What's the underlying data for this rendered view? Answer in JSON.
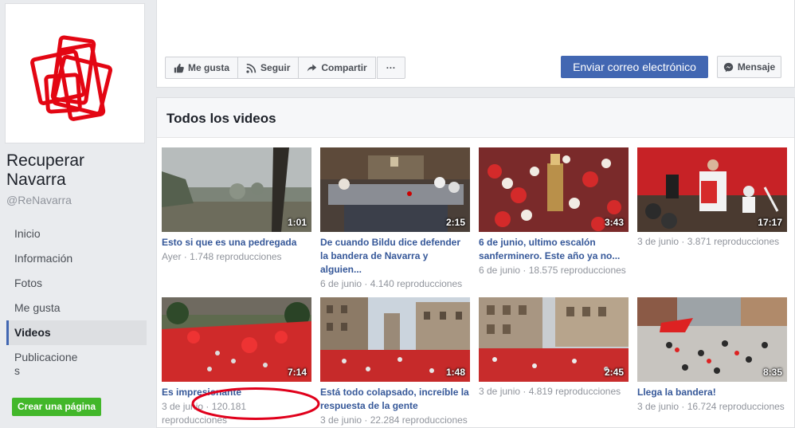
{
  "page": {
    "name": "Recuperar Navarra",
    "handle": "@ReNavarra"
  },
  "nav": {
    "items": [
      {
        "label": "Inicio"
      },
      {
        "label": "Información"
      },
      {
        "label": "Fotos"
      },
      {
        "label": "Me gusta"
      },
      {
        "label": "Videos",
        "active": true
      },
      {
        "label": "Publicaciones"
      }
    ],
    "create_page": "Crear una página"
  },
  "actions": {
    "like": "Me gusta",
    "follow": "Seguir",
    "share": "Compartir",
    "more": "···",
    "email": "Enviar correo electrónico",
    "message": "Mensaje"
  },
  "videos": {
    "title": "Todos los videos",
    "items": [
      {
        "title": "Esto si que es una pedregada",
        "date": "Ayer",
        "views": "1.748 reproducciones",
        "duration": "1:01"
      },
      {
        "title": "De cuando Bildu dice defender la bandera de Navarra y alguien...",
        "date": "6 de junio",
        "views": "4.140 reproducciones",
        "duration": "2:15"
      },
      {
        "title": "6 de junio, ultimo escalón sanferminero. Este año ya no...",
        "date": "6 de junio",
        "views": "18.575 reproducciones",
        "duration": "3:43"
      },
      {
        "title": "",
        "date": "3 de junio",
        "views": "3.871 reproducciones",
        "duration": "17:17"
      },
      {
        "title": "Es impresionante",
        "date": "3 de junio",
        "views": "120.181 reproducciones",
        "duration": "7:14"
      },
      {
        "title": "Está todo colapsado, increíble la respuesta de la gente",
        "date": "3 de junio",
        "views": "22.284 reproducciones",
        "duration": "1:48"
      },
      {
        "title": "",
        "date": "3 de junio",
        "views": "4.819 reproducciones",
        "duration": "2:45"
      },
      {
        "title": "Llega la bandera!",
        "date": "3 de junio",
        "views": "16.724 reproducciones",
        "duration": "8:35"
      }
    ]
  },
  "colors": {
    "brand_blue": "#4267b2",
    "link": "#365899",
    "green": "#42b72a",
    "annotation_red": "#e0001b"
  }
}
